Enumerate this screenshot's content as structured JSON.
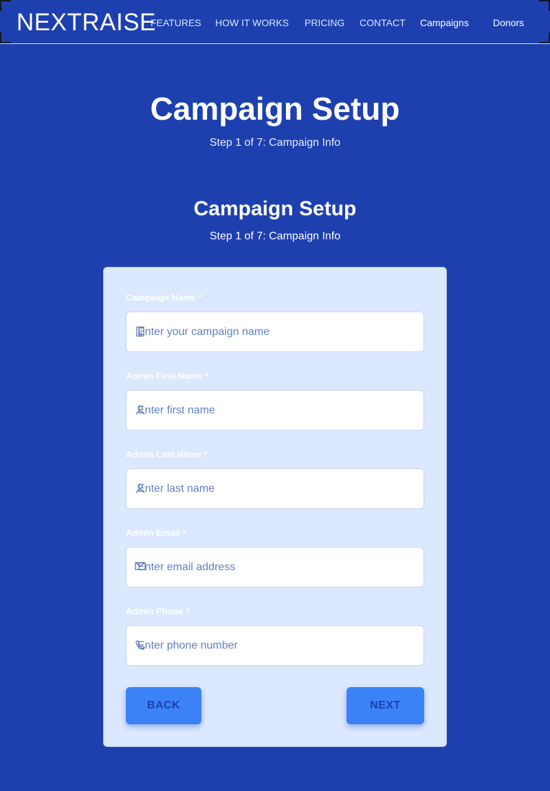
{
  "header": {
    "logo": "NEXTRAISE",
    "nav": [
      "FEATURES",
      "HOW IT WORKS",
      "PRICING",
      "CONTACT"
    ],
    "nav_right": [
      "Campaigns",
      "Donors"
    ]
  },
  "hero": {
    "title": "Campaign Setup",
    "subtitle": "Step 1 of 7: Campaign Info"
  },
  "section": {
    "title": "Campaign Setup",
    "subtitle": "Step 1 of 7: Campaign Info"
  },
  "form": {
    "fields": [
      {
        "label": "Campaign Name *",
        "placeholder": "Enter your campaign name",
        "icon": "building-icon"
      },
      {
        "label": "Admin First Name *",
        "placeholder": "Enter first name",
        "icon": "user-icon"
      },
      {
        "label": "Admin Last Name *",
        "placeholder": "Enter last name",
        "icon": "user-icon"
      },
      {
        "label": "Admin Email *",
        "placeholder": "Enter email address",
        "icon": "envelope-icon"
      },
      {
        "label": "Admin Phone *",
        "placeholder": "Enter phone number",
        "icon": "phone-icon"
      }
    ],
    "back_label": "BACK",
    "next_label": "NEXT"
  },
  "colors": {
    "background": "#1e40af",
    "card": "#dbe8fe",
    "button": "#3b82f6",
    "placeholder": "#5f7fc4"
  }
}
